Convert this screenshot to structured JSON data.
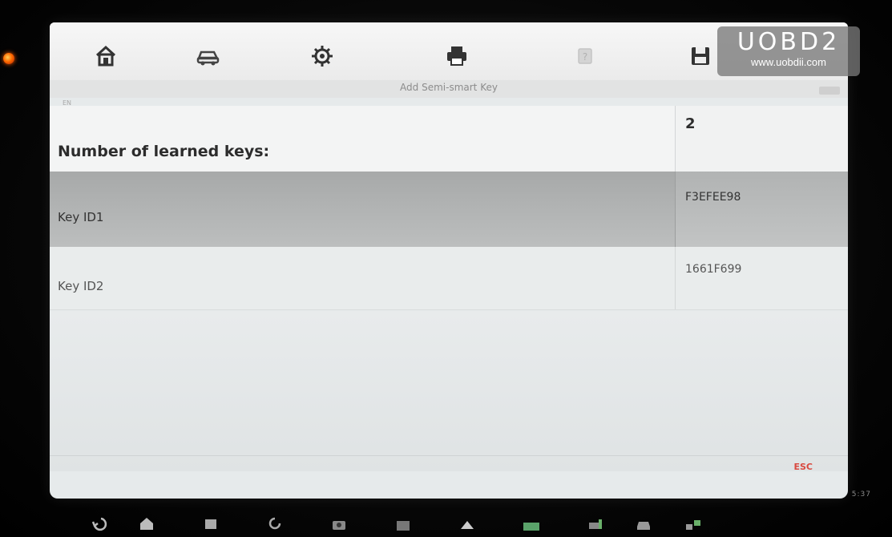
{
  "screen": {
    "page_title": "Add Semi-smart Key",
    "small_corner_label": "EN"
  },
  "toolbar": {
    "icons": [
      "home-icon",
      "vehicle-icon",
      "settings-gear-icon",
      "print-icon",
      "help-icon",
      "save-icon"
    ]
  },
  "table": {
    "header": {
      "label": "Number of learned keys:",
      "value": "2"
    },
    "rows": [
      {
        "label": "Key ID1",
        "value": "F3EFEE98",
        "selected": true
      },
      {
        "label": "Key ID2",
        "value": "1661F699",
        "selected": false
      }
    ]
  },
  "actions": {
    "esc_label": "ESC"
  },
  "status_bar": {
    "time": "5:37"
  },
  "watermark": {
    "brand": "UOBD2",
    "url": "www.uobdii.com"
  },
  "colors": {
    "selected_row": "#b0b2b2",
    "esc": "#d9493f",
    "screen_bg": "#e6eaeb"
  }
}
